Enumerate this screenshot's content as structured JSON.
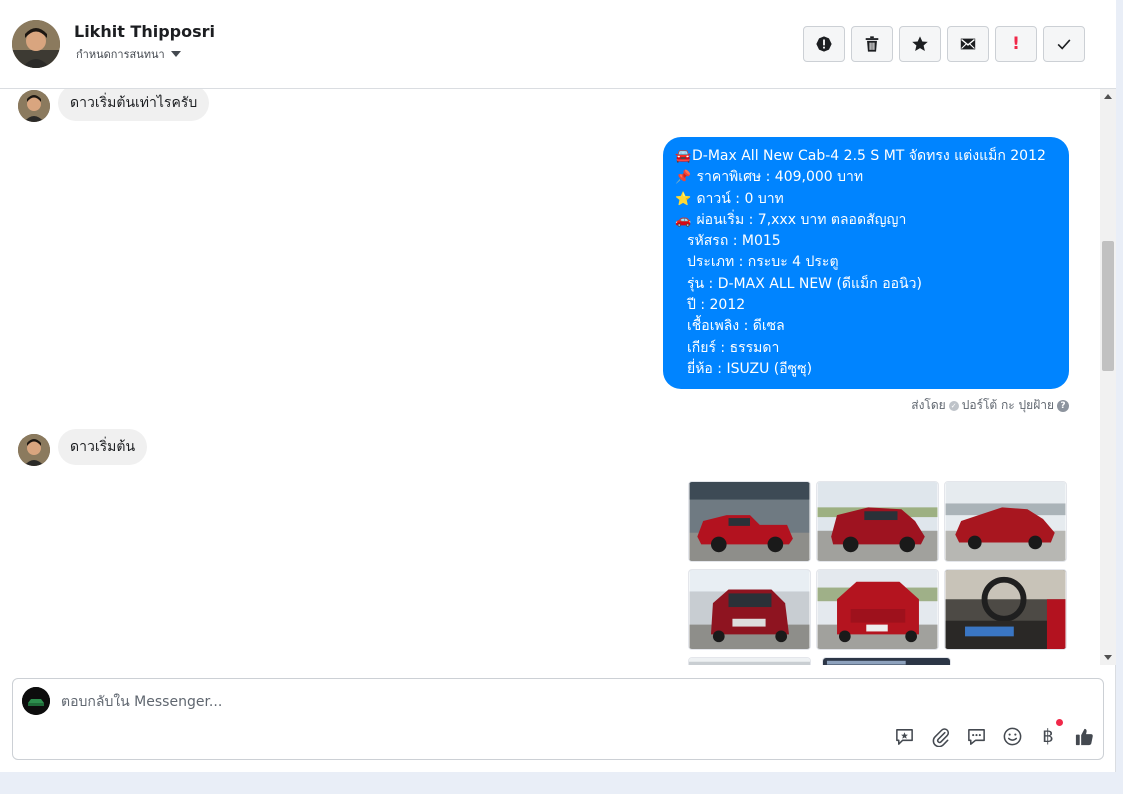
{
  "contact": {
    "name": "Likhit Thipposri",
    "subtitle": "กำหนดการสนทนา"
  },
  "toolbar": {
    "actions": [
      "spam-alert",
      "delete",
      "star",
      "mark-unread",
      "follow-up",
      "done"
    ],
    "follow_up_mark": "!"
  },
  "messages": {
    "m1": "ดาวเริ่มต้นเท่าไรครับ",
    "reply": {
      "lines": [
        {
          "emoji": "🚘",
          "text": "D-Max All New Cab-4 2.5 S MT จัดทรง แต่งแม็ก 2012"
        },
        {
          "emoji": "📌",
          "text": "ราคาพิเศษ : 409,000 บาท"
        },
        {
          "emoji": "⭐",
          "text": "ดาวน์ : 0 บาท"
        },
        {
          "emoji": "🚗",
          "text": "ผ่อนเริ่ม : 7,xxx บาท ตลอดสัญญา"
        },
        {
          "emoji": "",
          "text": "รหัสรถ : M015"
        },
        {
          "emoji": "",
          "text": "ประเภท : กระบะ 4 ประตู"
        },
        {
          "emoji": "",
          "text": "รุ่น : D-MAX ALL NEW (ดีแม็ก ออนิว)"
        },
        {
          "emoji": "",
          "text": "ปี : 2012"
        },
        {
          "emoji": "",
          "text": "เชื้อเพลิง : ดีเซล"
        },
        {
          "emoji": "",
          "text": "เกียร์ : ธรรมดา"
        },
        {
          "emoji": "",
          "text": "ยี่ห้อ : ISUZU (อีซูซุ)"
        }
      ],
      "sent_by_label": "ส่งโดย",
      "sender": "ปอร์โต้ กะ ปุยฝ้าย",
      "help_mark": "?"
    },
    "m2": "ดาวเริ่มต้น"
  },
  "photos": {
    "count_visible": 8,
    "colors": {
      "car": "#b3121f",
      "ground": "#9a9a96",
      "sky": "#dfe6ec"
    }
  },
  "composer": {
    "placeholder": "ตอบกลับใน Messenger...",
    "tools": [
      "saved-reply-icon",
      "attachment-icon",
      "quick-reply-icon",
      "emoji-icon",
      "payment-icon",
      "like-icon"
    ],
    "baht_symbol": "฿"
  },
  "colors": {
    "outgoing_bubble": "#0084ff",
    "incoming_bubble": "#f0f0f0",
    "follow_up_red": "#f02849"
  }
}
